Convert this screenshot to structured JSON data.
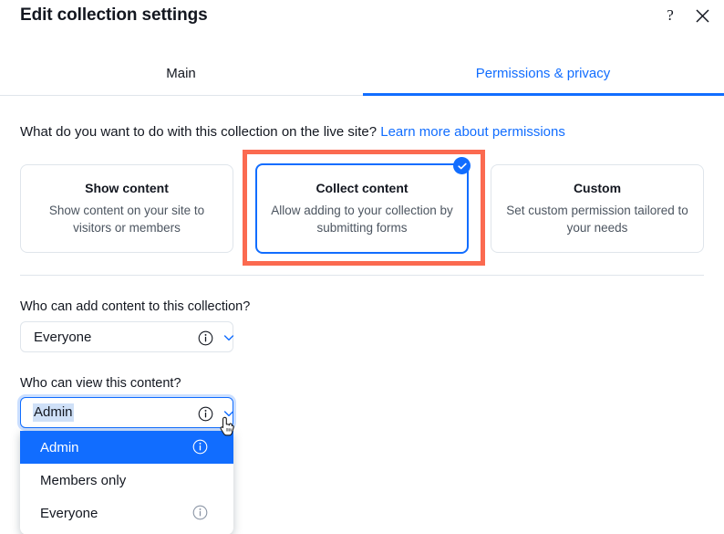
{
  "dialog": {
    "title": "Edit collection settings",
    "help_icon": "question-mark-icon",
    "help_label": "?",
    "close_icon": "close-icon"
  },
  "tabs": [
    {
      "label": "Main",
      "active": false
    },
    {
      "label": "Permissions & privacy",
      "active": true
    }
  ],
  "question": {
    "text": "What do you want to do with this collection on the live site?",
    "link_label": "Learn more about permissions"
  },
  "option_cards": [
    {
      "title": "Show content",
      "description": "Show content on your site to visitors or members",
      "selected": false
    },
    {
      "title": "Collect content",
      "description": "Allow adding to your collection by submitting forms",
      "selected": true
    },
    {
      "title": "Custom",
      "description": "Set custom permission tailored to your needs",
      "selected": false
    }
  ],
  "fields": [
    {
      "label": "Who can add content to this collection?",
      "value": "Everyone",
      "info_icon": "info-icon",
      "chevron_icon": "chevron-down-icon",
      "open": false
    },
    {
      "label": "Who can view this content?",
      "value": "Admin",
      "info_icon": "info-icon",
      "chevron_icon": "chevron-down-icon",
      "open": true
    }
  ],
  "dropdown": {
    "options": [
      {
        "label": "Admin",
        "selected": true,
        "has_info": true
      },
      {
        "label": "Members only",
        "selected": false,
        "has_info": false
      },
      {
        "label": "Everyone",
        "selected": false,
        "has_info": true
      }
    ]
  },
  "annotation": {
    "type": "highlight-rectangle",
    "color": "#fb6a50",
    "target": "Collect content"
  },
  "colors": {
    "accent": "#116dff",
    "text": "#131720",
    "muted_text": "#4c5560",
    "border": "#dfe5eb",
    "annotation": "#fb6a50",
    "selection_highlight": "#cfe0f7"
  },
  "cursor": {
    "type": "pointer-hand-cursor"
  }
}
